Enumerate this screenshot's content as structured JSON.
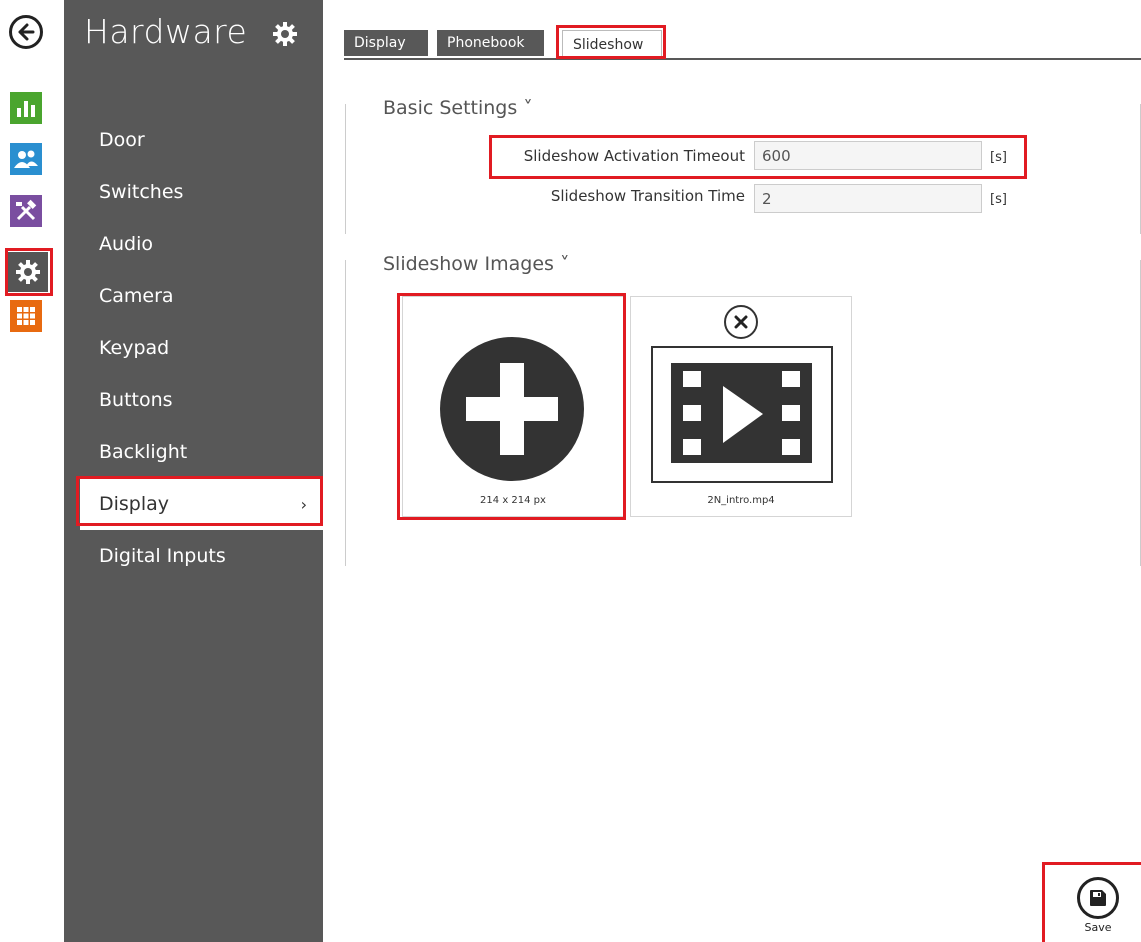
{
  "rail": {
    "items": [
      {
        "name": "back-icon"
      },
      {
        "name": "status-icon",
        "color": "#4aa52e"
      },
      {
        "name": "directory-icon",
        "color": "#2a8fd0"
      },
      {
        "name": "services-icon",
        "color": "#7a4ea0"
      },
      {
        "name": "hardware-gear-icon",
        "color": "#555555"
      },
      {
        "name": "system-grid-icon",
        "color": "#e86a10"
      }
    ]
  },
  "sidebar": {
    "title": "Hardware",
    "items": [
      {
        "label": "Door"
      },
      {
        "label": "Switches"
      },
      {
        "label": "Audio"
      },
      {
        "label": "Camera"
      },
      {
        "label": "Keypad"
      },
      {
        "label": "Buttons"
      },
      {
        "label": "Backlight"
      },
      {
        "label": "Display",
        "active": true,
        "chevron": "›"
      },
      {
        "label": "Digital Inputs"
      }
    ]
  },
  "tabs": [
    {
      "label": "Display"
    },
    {
      "label": "Phonebook"
    },
    {
      "label": "Slideshow",
      "active": true
    }
  ],
  "basic_settings": {
    "title": "Basic Settings ˅",
    "fields": [
      {
        "label": "Slideshow Activation Timeout",
        "value": "600",
        "unit": "[s]"
      },
      {
        "label": "Slideshow Transition Time",
        "value": "2",
        "unit": "[s]"
      }
    ]
  },
  "slideshow_images": {
    "title": "Slideshow Images ˅",
    "tiles": [
      {
        "caption": "214 x 214 px",
        "icon": "add-icon"
      },
      {
        "caption": "2N_intro.mp4",
        "icon": "video-icon"
      }
    ]
  },
  "save": {
    "label": "Save"
  },
  "colors": {
    "highlight": "#e11b22",
    "sidebar": "#585858"
  }
}
